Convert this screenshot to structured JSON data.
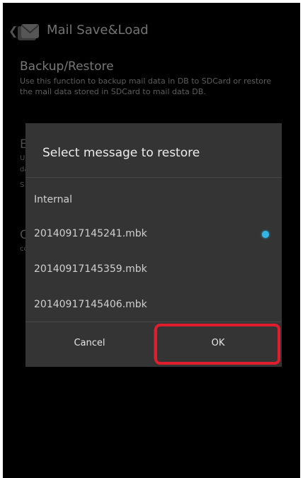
{
  "action_bar": {
    "back_icon": "chevron-left-icon",
    "app_icon": "mail-icon",
    "title": "Mail Save&Load"
  },
  "section": {
    "title": "Backup/Restore",
    "description": "Use this function to backup mail data in DB to SDCard or restore the mail data stored in SDCard to mail data DB."
  },
  "background_fragments": [
    "E",
    "C",
    "co",
    "Us",
    "da",
    "S"
  ],
  "dialog": {
    "title": "Select message to restore",
    "options": [
      {
        "label": "Internal",
        "selected": false
      },
      {
        "label": "20140917145241.mbk",
        "selected": true
      },
      {
        "label": "20140917145359.mbk",
        "selected": false
      },
      {
        "label": "20140917145406.mbk",
        "selected": false
      }
    ],
    "cancel_label": "Cancel",
    "ok_label": "OK"
  },
  "colors": {
    "highlight": "#e01d2c",
    "radio_selected": "#33b5e5"
  }
}
